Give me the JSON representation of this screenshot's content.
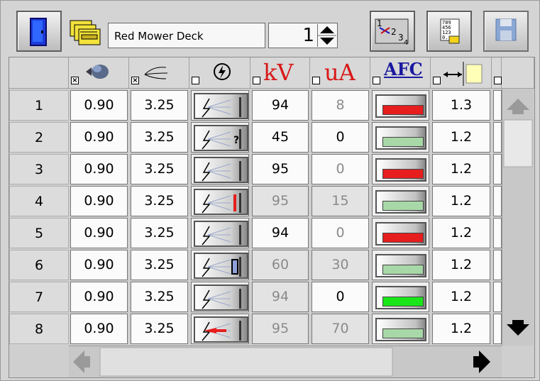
{
  "toolbar": {
    "exit_icon": "door-icon",
    "program_icon": "mower-deck-icon",
    "sequence_icon": "sequence-icon",
    "keypad_icon": "keypad-icon",
    "save_icon": "floppy-disk-icon"
  },
  "program": {
    "name": "Red Mower Deck",
    "number": "1"
  },
  "columns": [
    {
      "key": "atomizing_air",
      "icon": "paint-cloud-icon",
      "checked": true
    },
    {
      "key": "fan_air",
      "icon": "fan-air-icon",
      "checked": true
    },
    {
      "key": "electrostatic",
      "icon": "lightning-icon",
      "checked": false
    },
    {
      "key": "kv",
      "label": "kV",
      "checked": false
    },
    {
      "key": "ua",
      "label": "uA",
      "checked": false
    },
    {
      "key": "afc",
      "label": "AFC",
      "checked": false
    },
    {
      "key": "distance",
      "icon": "distance-icon",
      "checked": false
    }
  ],
  "rows": [
    {
      "num": "1",
      "air": "0.90",
      "fan": "3.25",
      "gun": "normal",
      "kv": "94",
      "ua": "8",
      "afc": "red",
      "dist": "1.3"
    },
    {
      "num": "2",
      "air": "0.90",
      "fan": "3.25",
      "gun": "question",
      "kv": "45",
      "ua": "0",
      "afc": "gray",
      "dist": "1.2"
    },
    {
      "num": "3",
      "air": "0.90",
      "fan": "3.25",
      "gun": "normal",
      "kv": "95",
      "ua": "0",
      "afc": "red",
      "dist": "1.2"
    },
    {
      "num": "4",
      "air": "0.90",
      "fan": "3.25",
      "gun": "redbar",
      "kv": "95",
      "ua": "15",
      "afc": "gray",
      "dist": "1.2"
    },
    {
      "num": "5",
      "air": "0.90",
      "fan": "3.25",
      "gun": "normal",
      "kv": "94",
      "ua": "0",
      "afc": "red",
      "dist": "1.2"
    },
    {
      "num": "6",
      "air": "0.90",
      "fan": "3.25",
      "gun": "bracket",
      "kv": "60",
      "ua": "30",
      "afc": "gray",
      "dist": "1.2"
    },
    {
      "num": "7",
      "air": "0.90",
      "fan": "3.25",
      "gun": "normal",
      "kv": "94",
      "ua": "0",
      "afc": "green",
      "dist": "1.2"
    },
    {
      "num": "8",
      "air": "0.90",
      "fan": "3.25",
      "gun": "redarrow",
      "kv": "95",
      "ua": "70",
      "afc": "gray",
      "dist": "1.2"
    }
  ],
  "colors": {
    "red": "#e61e1e",
    "green": "#19e619",
    "gray": "#a8d8a8",
    "kv_header": "#d81818",
    "afc_header": "#1a1aa0"
  }
}
